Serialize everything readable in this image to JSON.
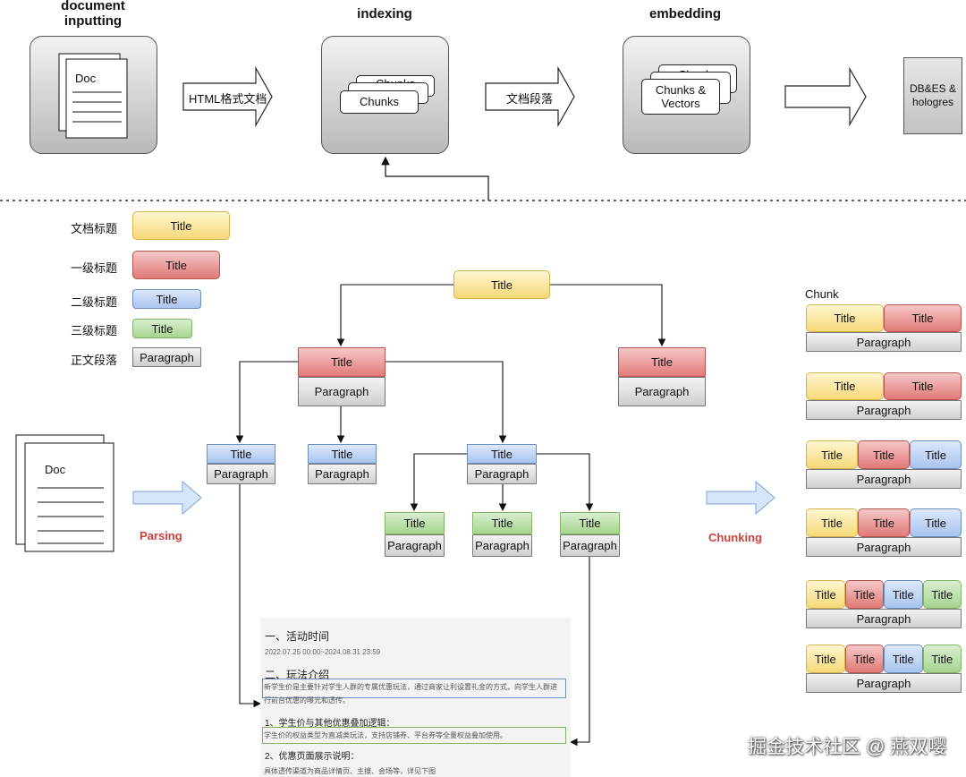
{
  "pipeline": {
    "stage1_label": "document\ninputting",
    "stage2_label": "indexing",
    "stage3_label": "embedding",
    "doc_card": "Doc",
    "chunks_card": "Chunks",
    "chunks_back": "Chunks",
    "vectors_card": "Chunks &\nVectors",
    "vectors_back": "Chunks",
    "arrow1_label": "HTML格式文档",
    "arrow2_label": "文档段落",
    "db_label": "DB&ES &\nhologres"
  },
  "legend": [
    {
      "label": "文档标题",
      "box": "Title",
      "color": "yellow"
    },
    {
      "label": "一级标题",
      "box": "Title",
      "color": "red"
    },
    {
      "label": "二级标题",
      "box": "Title",
      "color": "blue"
    },
    {
      "label": "三级标题",
      "box": "Title",
      "color": "green"
    },
    {
      "label": "正文段落",
      "box": "Paragraph",
      "color": "grey"
    }
  ],
  "tree": {
    "title": "Title",
    "paragraph": "Paragraph"
  },
  "left_doc": "Doc",
  "parsing_label": "Parsing",
  "chunking_label": "Chunking",
  "chunk_label": "Chunk",
  "chunks": [
    {
      "titles": [
        {
          "t": "Title",
          "c": "yellow"
        },
        {
          "t": "Title",
          "c": "red"
        }
      ],
      "paragraph": "Paragraph"
    },
    {
      "titles": [
        {
          "t": "Title",
          "c": "yellow"
        },
        {
          "t": "Title",
          "c": "red"
        }
      ],
      "paragraph": "Paragraph"
    },
    {
      "titles": [
        {
          "t": "Title",
          "c": "yellow"
        },
        {
          "t": "Title",
          "c": "red"
        },
        {
          "t": "Title",
          "c": "blue"
        }
      ],
      "paragraph": "Paragraph"
    },
    {
      "titles": [
        {
          "t": "Title",
          "c": "yellow"
        },
        {
          "t": "Title",
          "c": "red"
        },
        {
          "t": "Title",
          "c": "blue"
        }
      ],
      "paragraph": "Paragraph"
    },
    {
      "titles": [
        {
          "t": "Title",
          "c": "yellow"
        },
        {
          "t": "Title",
          "c": "red"
        },
        {
          "t": "Title",
          "c": "blue"
        },
        {
          "t": "Title",
          "c": "green"
        }
      ],
      "paragraph": "Paragraph"
    },
    {
      "titles": [
        {
          "t": "Title",
          "c": "yellow"
        },
        {
          "t": "Title",
          "c": "red"
        },
        {
          "t": "Title",
          "c": "blue"
        },
        {
          "t": "Title",
          "c": "green"
        }
      ],
      "paragraph": "Paragraph"
    }
  ],
  "screenshot": {
    "h1": "一、活动时间",
    "date": "2022.07.25 00:00~2024.08.31 23:59",
    "h2": "二、玩法介绍",
    "p1a": "新学生价是主要针对学生人群的专属优惠玩法，通过商家让利设置礼金的方式，向学生人群进",
    "p1b": "行前台优惠的曝光和透传。",
    "h3": "1、学生价与其他优惠叠加逻辑：",
    "p2": "学生价的权益类型为直减类玩法，支持店铺券、平台券等全量权益叠加使用。",
    "h4": "2、优惠页面展示说明：",
    "p3": "具体透传渠道为商品详情页、主搜、会场等，详见下图"
  },
  "watermark": "掘金技术社区 @ 燕双嘤",
  "colors": {
    "yellow": "#f7d97a",
    "red": "#e07a78",
    "blue": "#a9c4ee",
    "green": "#a6d48f",
    "grey": "#cfcfcf",
    "accent_red": "#d0403a"
  }
}
